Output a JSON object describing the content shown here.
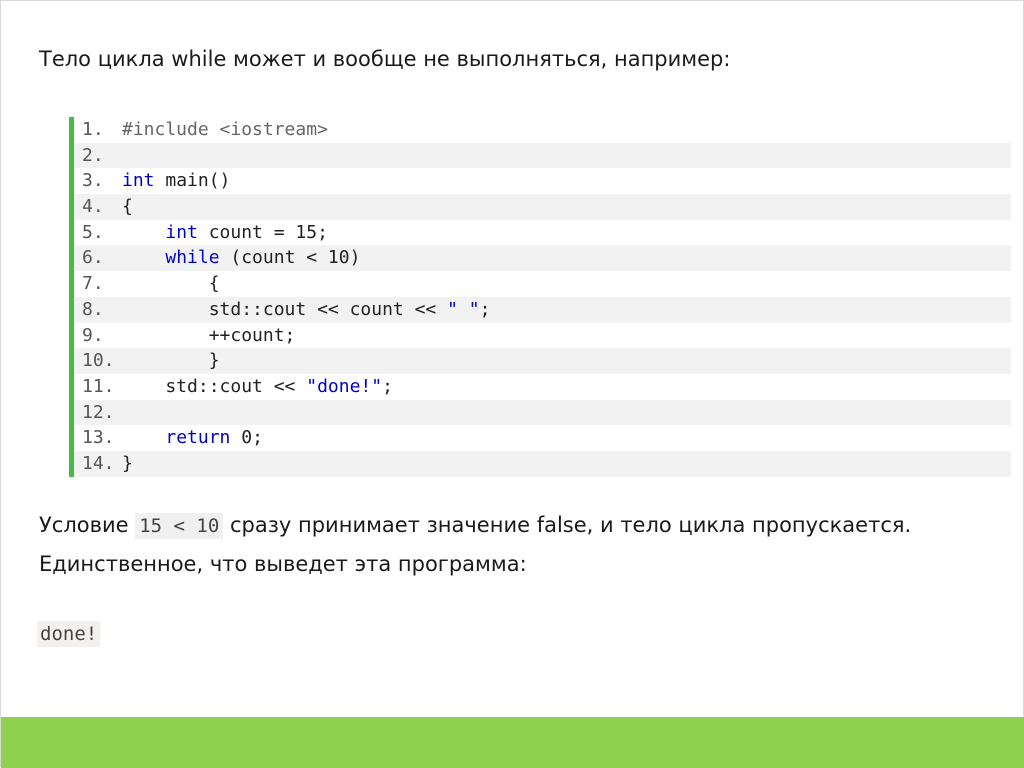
{
  "intro_text": "Тело цикла while может и вообще не выполняться, например:",
  "code_lines": [
    {
      "num": "1.",
      "parts": [
        {
          "t": "#include <iostream>",
          "c": "pp"
        }
      ]
    },
    {
      "num": "2.",
      "parts": []
    },
    {
      "num": "3.",
      "parts": [
        {
          "t": "int",
          "c": "kw"
        },
        {
          "t": " main()",
          "c": "txt"
        }
      ]
    },
    {
      "num": "4.",
      "parts": [
        {
          "t": "{",
          "c": "txt"
        }
      ]
    },
    {
      "num": "5.",
      "parts": [
        {
          "t": "    ",
          "c": "txt"
        },
        {
          "t": "int",
          "c": "kw"
        },
        {
          "t": " count = 15;",
          "c": "txt"
        }
      ]
    },
    {
      "num": "6.",
      "parts": [
        {
          "t": "    ",
          "c": "txt"
        },
        {
          "t": "while",
          "c": "kw"
        },
        {
          "t": " (count < 10)",
          "c": "txt"
        }
      ]
    },
    {
      "num": "7.",
      "parts": [
        {
          "t": "        {",
          "c": "txt"
        }
      ]
    },
    {
      "num": "8.",
      "parts": [
        {
          "t": "        std::cout << count << ",
          "c": "txt"
        },
        {
          "t": "\" \"",
          "c": "str"
        },
        {
          "t": ";",
          "c": "txt"
        }
      ]
    },
    {
      "num": "9.",
      "parts": [
        {
          "t": "        ++count;",
          "c": "txt"
        }
      ]
    },
    {
      "num": "10.",
      "parts": [
        {
          "t": "        }",
          "c": "txt"
        }
      ]
    },
    {
      "num": "11.",
      "parts": [
        {
          "t": "    std::cout << ",
          "c": "txt"
        },
        {
          "t": "\"done!\"",
          "c": "str"
        },
        {
          "t": ";",
          "c": "txt"
        }
      ]
    },
    {
      "num": "12.",
      "parts": []
    },
    {
      "num": "13.",
      "parts": [
        {
          "t": "    ",
          "c": "txt"
        },
        {
          "t": "return",
          "c": "kw"
        },
        {
          "t": " 0;",
          "c": "txt"
        }
      ]
    },
    {
      "num": "14.",
      "parts": [
        {
          "t": "}",
          "c": "txt"
        }
      ]
    }
  ],
  "para1": {
    "before": "Условие ",
    "code": "15 < 10",
    "after": " сразу принимает значение false, и тело цикла пропускается."
  },
  "para2": "Единственное, что выведет эта программа:",
  "output_text": "done!",
  "colors": {
    "accent_green": "#46b946",
    "footer_green": "#8fd14f",
    "keyword_blue": "#0000cc"
  }
}
